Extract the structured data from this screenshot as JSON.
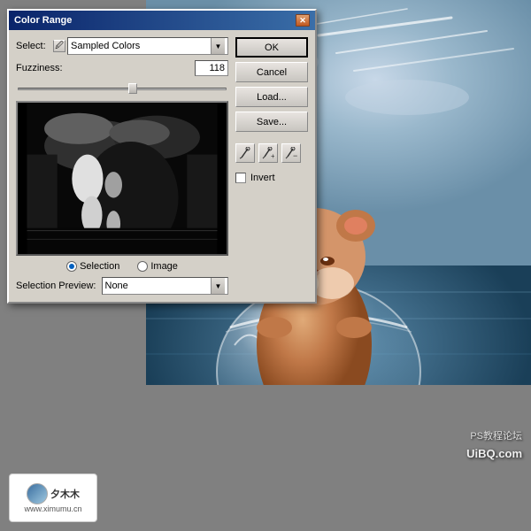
{
  "dialog": {
    "title": "Color Range",
    "select_label": "Select:",
    "select_value": "Sampled Colors",
    "fuzziness_label": "Fuzziness:",
    "fuzziness_value": "118",
    "slider_percent": 53,
    "radio_options": [
      "Selection",
      "Image"
    ],
    "radio_selected": "Selection",
    "sel_preview_label": "Selection Preview:",
    "sel_preview_value": "None",
    "invert_label": "Invert",
    "invert_checked": false,
    "buttons": {
      "ok": "OK",
      "cancel": "Cancel",
      "load": "Load...",
      "save": "Save..."
    }
  },
  "watermark": {
    "text1": "夕木木",
    "text2": "www.ximumu.cn"
  },
  "badges": {
    "ps": "PS教程论坛",
    "uibq": "UiBQ.com"
  },
  "icons": {
    "close": "✕",
    "arrow_down": "▼",
    "eyedropper": "🖉",
    "eyedropper_plus": "+",
    "eyedropper_minus": "−"
  }
}
